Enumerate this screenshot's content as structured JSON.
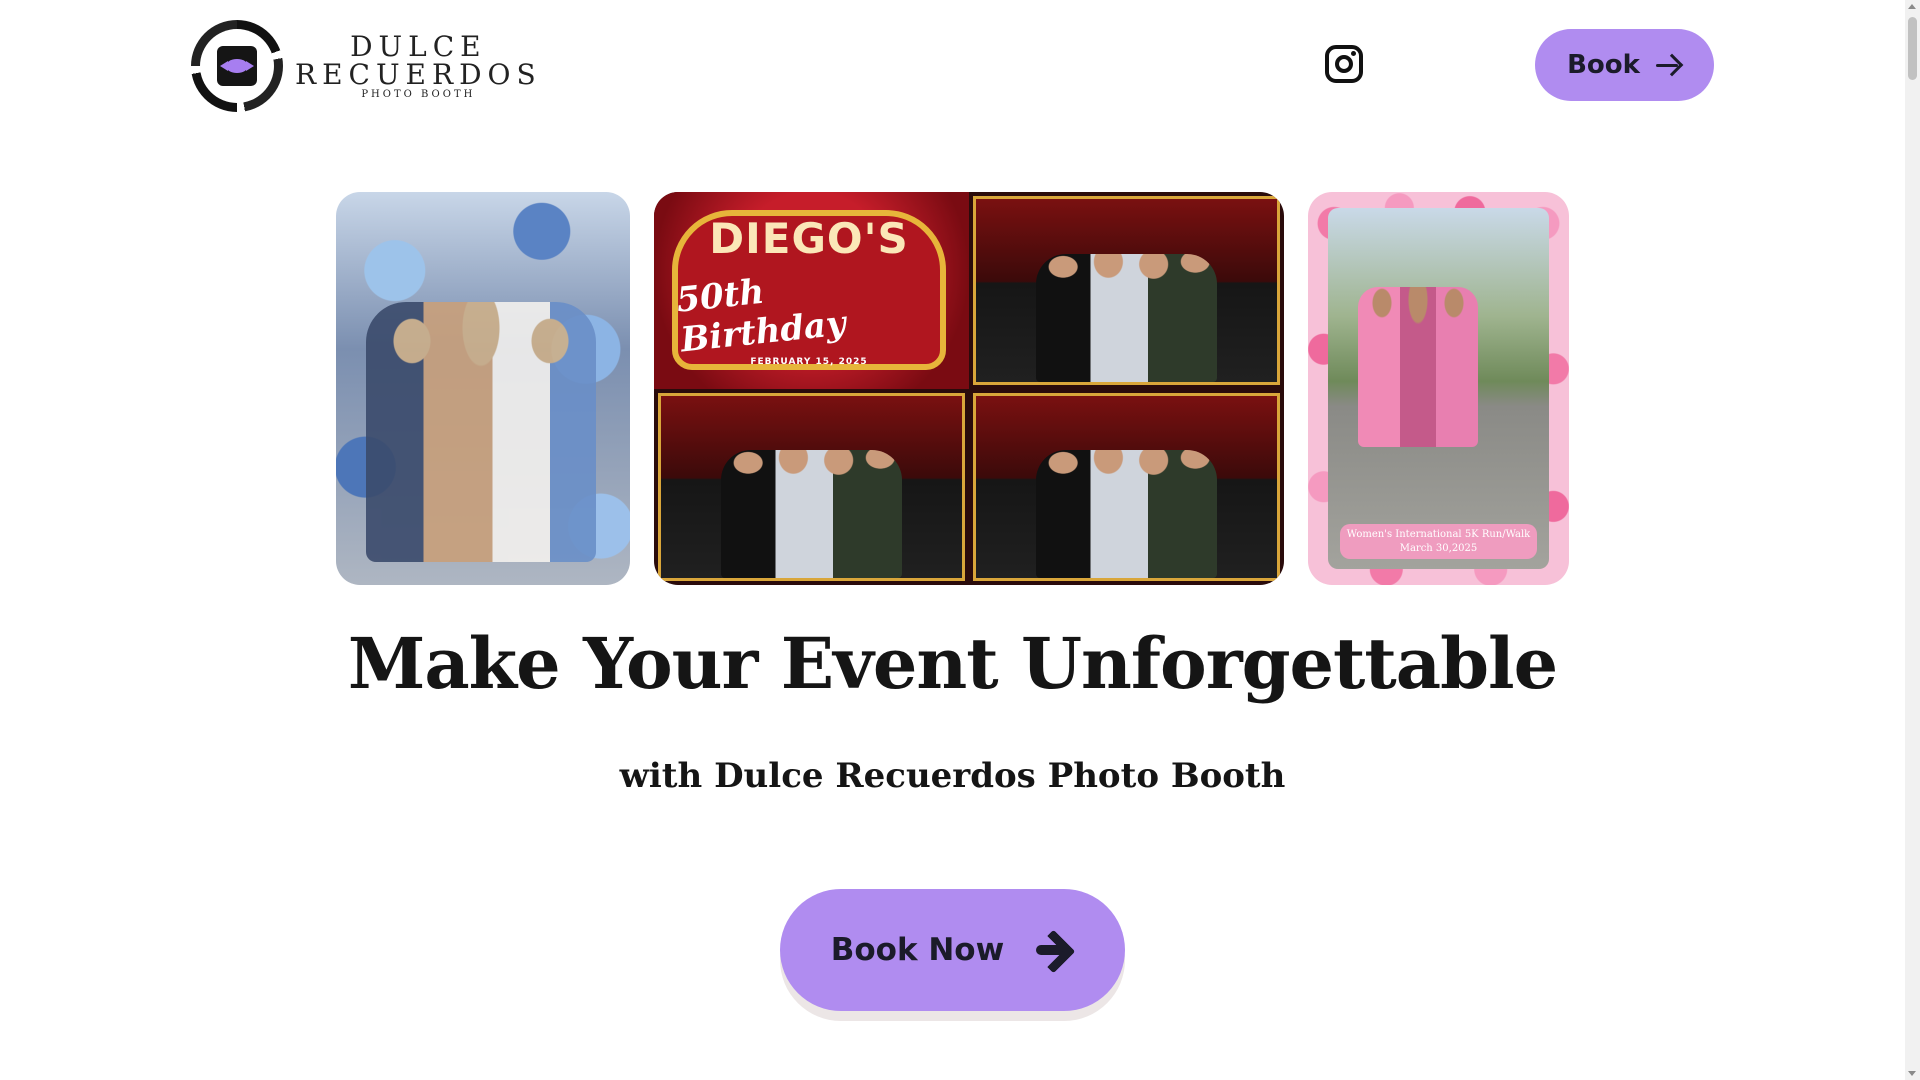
{
  "header": {
    "logo": {
      "line1": "DULCE",
      "line2": "RECUERDOS",
      "line3": "PHOTO BOOTH"
    },
    "instagram_icon": "instagram-icon",
    "book_label": "Book",
    "book_icon": "arrow-right-icon"
  },
  "gallery": {
    "photo2": {
      "title": "DIEGO'S",
      "subtitle": "50th Birthday",
      "date": "FEBRUARY 15, 2025"
    },
    "photo3": {
      "caption_line1": "Women's International 5K Run/Walk",
      "caption_line2": "March 30,2025"
    }
  },
  "hero": {
    "headline": "Make Your Event Unforgettable",
    "subheadline": "with Dulce Recuerdos Photo Booth",
    "cta_label": "Book Now",
    "cta_icon": "arrow-right-icon"
  },
  "colors": {
    "accent": "#b08cf0",
    "text": "#151515",
    "background": "#ffffff"
  }
}
